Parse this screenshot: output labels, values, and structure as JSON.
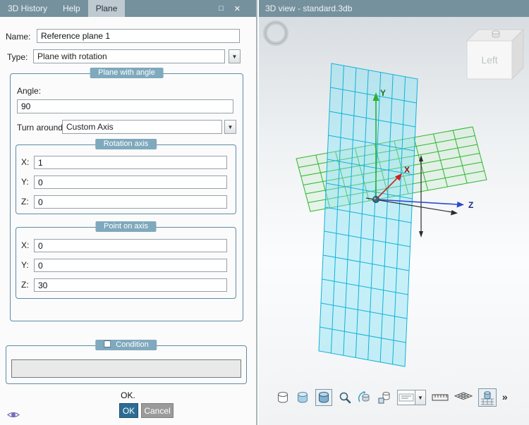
{
  "left_panel": {
    "titlebar": {
      "tabs": [
        "3D History",
        "Help",
        "Plane"
      ],
      "maximize_glyph": "□",
      "close_glyph": "✕"
    },
    "name": {
      "label": "Name:",
      "value": "Reference plane 1"
    },
    "type": {
      "label": "Type:",
      "value": "Plane with rotation"
    },
    "plane_with_angle": {
      "title": "Plane with angle",
      "angle": {
        "label": "Angle:",
        "value": "90"
      },
      "turn_around": {
        "label": "Turn around",
        "value": "Custom Axis"
      },
      "rotation_axis": {
        "title": "Rotation axis",
        "rows": [
          {
            "label": "X:",
            "value": "1"
          },
          {
            "label": "Y:",
            "value": "0"
          },
          {
            "label": "Z:",
            "value": "0"
          }
        ]
      },
      "point_on_axis": {
        "title": "Point on axis",
        "rows": [
          {
            "label": "X:",
            "value": "0"
          },
          {
            "label": "Y:",
            "value": "0"
          },
          {
            "label": "Z:",
            "value": "30"
          }
        ]
      }
    },
    "condition": {
      "title": "Condition",
      "checked": false,
      "value": ""
    },
    "status_text": "OK.",
    "buttons": {
      "ok": "OK",
      "cancel": "Cancel"
    }
  },
  "right_panel": {
    "title": "3D view - standard.3db",
    "nav_cube": {
      "face_label": "Left"
    },
    "axes": {
      "x": "X",
      "y": "Y",
      "z": "Z"
    },
    "toolbar": {
      "overflow_glyph": "»"
    }
  },
  "colors": {
    "titlebar": "#75919e",
    "active_tab": "#bfcad0",
    "group_border": "#5e8ca6",
    "badge": "#7fa9bd",
    "ok_button": "#2d6d94",
    "cancel_button": "#9b9b9b",
    "plane_green": "#2db52d",
    "plane_cyan": "#12b2d8",
    "axis_x": "#cc2222",
    "axis_y": "#2fae2f",
    "axis_z": "#2b49cf"
  }
}
